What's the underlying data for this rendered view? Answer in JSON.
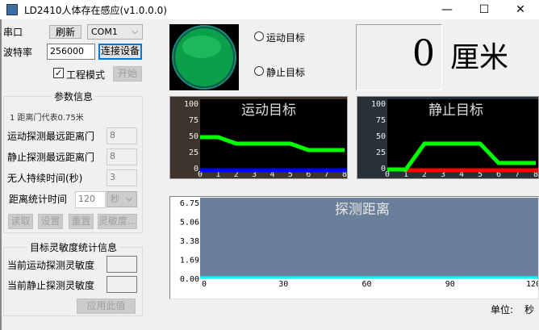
{
  "window": {
    "title": "LD2410人体存在感应(v1.0.0.0)",
    "minimize": "—",
    "maximize": "☐",
    "close": "✕"
  },
  "serial": {
    "label": "串口",
    "refresh": "刷新",
    "port": "COM1",
    "baud_label": "波特率",
    "baud": "256000",
    "connect": "连接设备",
    "eng_mode": "工程模式",
    "eng_checked": true,
    "start": "开始"
  },
  "params": {
    "title": "参数信息",
    "note": "1 距离门代表0.75米",
    "motion_gate_label": "运动探测最远距离门",
    "motion_gate": "8",
    "static_gate_label": "静止探测最远距离门",
    "static_gate": "8",
    "nobody_label": "无人持续时间(秒)",
    "nobody": "3",
    "stat_time_label": "距离统计时间",
    "stat_time": "120",
    "stat_unit": "秒",
    "read": "读取",
    "set": "设置",
    "reset": "重置",
    "sens": "灵敏度..."
  },
  "sens": {
    "title": "目标灵敏度统计信息",
    "motion_label": "当前运动探测灵敏度",
    "static_label": "当前静止探测灵敏度",
    "apply": "应用此值"
  },
  "status": {
    "motion": "运动目标",
    "static": "静止目标",
    "distance": "0",
    "unit": "厘米"
  },
  "footer": {
    "unit_label": "单位:",
    "unit": "秒"
  },
  "chart_data": [
    {
      "type": "line",
      "title": "运动目标",
      "categories": [
        0,
        1,
        2,
        3,
        4,
        5,
        6,
        7,
        8
      ],
      "yticks": [
        100,
        75,
        50,
        25,
        0
      ],
      "ylim": [
        0,
        100
      ],
      "series": [
        {
          "name": "energy",
          "color": "#00ff00",
          "values": [
            50,
            50,
            40,
            40,
            40,
            40,
            30,
            30,
            30
          ]
        },
        {
          "name": "threshold",
          "color": "#0000ff",
          "values": [
            0,
            0,
            0,
            0,
            0,
            0,
            0,
            0,
            0
          ]
        }
      ]
    },
    {
      "type": "line",
      "title": "静止目标",
      "categories": [
        0,
        1,
        2,
        3,
        4,
        5,
        6,
        7,
        8
      ],
      "yticks": [
        100,
        75,
        50,
        25,
        0
      ],
      "ylim": [
        0,
        100
      ],
      "series": [
        {
          "name": "threshold",
          "color": "#ff0000",
          "values": [
            null,
            0,
            0,
            0,
            0,
            0,
            0,
            0,
            0
          ]
        },
        {
          "name": "energy",
          "color": "#00ff00",
          "values": [
            0,
            0,
            40,
            40,
            40,
            40,
            10,
            10,
            10
          ]
        }
      ]
    },
    {
      "type": "line",
      "title": "探测距离",
      "xticks": [
        0,
        30,
        60,
        90,
        120
      ],
      "yticks": [
        "6.75",
        "5.06",
        "3.38",
        "1.69",
        "0.00"
      ],
      "ylim": [
        0,
        6.75
      ],
      "xlim": [
        0,
        120
      ],
      "series": [
        {
          "name": "distance",
          "color": "#00ffff",
          "values": [
            0,
            0
          ]
        }
      ]
    }
  ]
}
